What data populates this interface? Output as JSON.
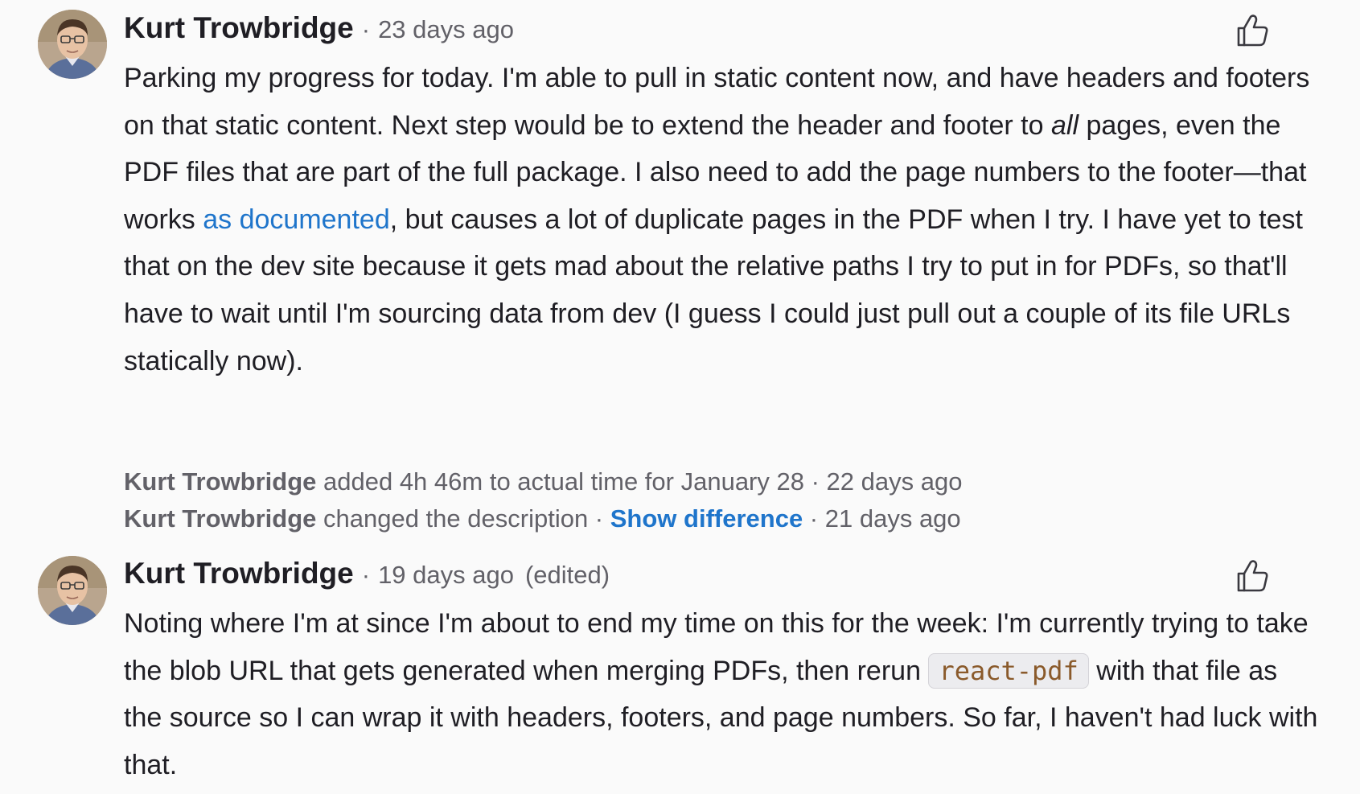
{
  "comments": [
    {
      "author": "Kurt Trowbridge",
      "separator": "·",
      "timestamp": "23 days ago",
      "edited": "",
      "body": {
        "p1": "Parking my progress for today. I'm able to pull in static content now, and have headers and footers on that static content. Next step would be to extend the header and footer to ",
        "emphasis": "all",
        "p2": " pages, even the PDF files that are part of the full package. I also need to add the page numbers to the footer—that works ",
        "link": "as documented",
        "p3": ", but causes a lot of duplicate pages in the PDF when I try. I have yet to test that on the dev site because it gets mad about the relative paths I try to put in for PDFs, so that'll have to wait until I'm sourcing data from dev (I guess I could just pull out a couple of its file URLs statically now)."
      }
    },
    {
      "author": "Kurt Trowbridge",
      "separator": "·",
      "timestamp": "19 days ago",
      "edited": "(edited)",
      "body": {
        "p1": "Noting where I'm at since I'm about to end my time on this for the week: I'm currently trying to take the blob URL that gets generated when merging PDFs, then rerun ",
        "code": "react-pdf",
        "p2": " with that file as the source so I can wrap it with headers, footers, and page numbers. So far, I haven't had luck with that."
      }
    }
  ],
  "system_notes": [
    {
      "author": "Kurt Trowbridge",
      "action": " added 4h 46m to actual time for January 28",
      "link": "",
      "separator": " · ",
      "timestamp": "22 days ago"
    },
    {
      "author": "Kurt Trowbridge",
      "action": " changed the description",
      "sep_before_link": " · ",
      "link": "Show difference",
      "separator": " · ",
      "timestamp": "21 days ago"
    }
  ],
  "icons": {
    "avatar": "avatar",
    "like": "thumbs-up-icon"
  },
  "colors": {
    "link": "#1f75cb",
    "text": "#1f1e24",
    "muted": "#626168",
    "code_text": "#8a5a2b",
    "code_bg": "#ececef",
    "background": "#fafafa"
  }
}
